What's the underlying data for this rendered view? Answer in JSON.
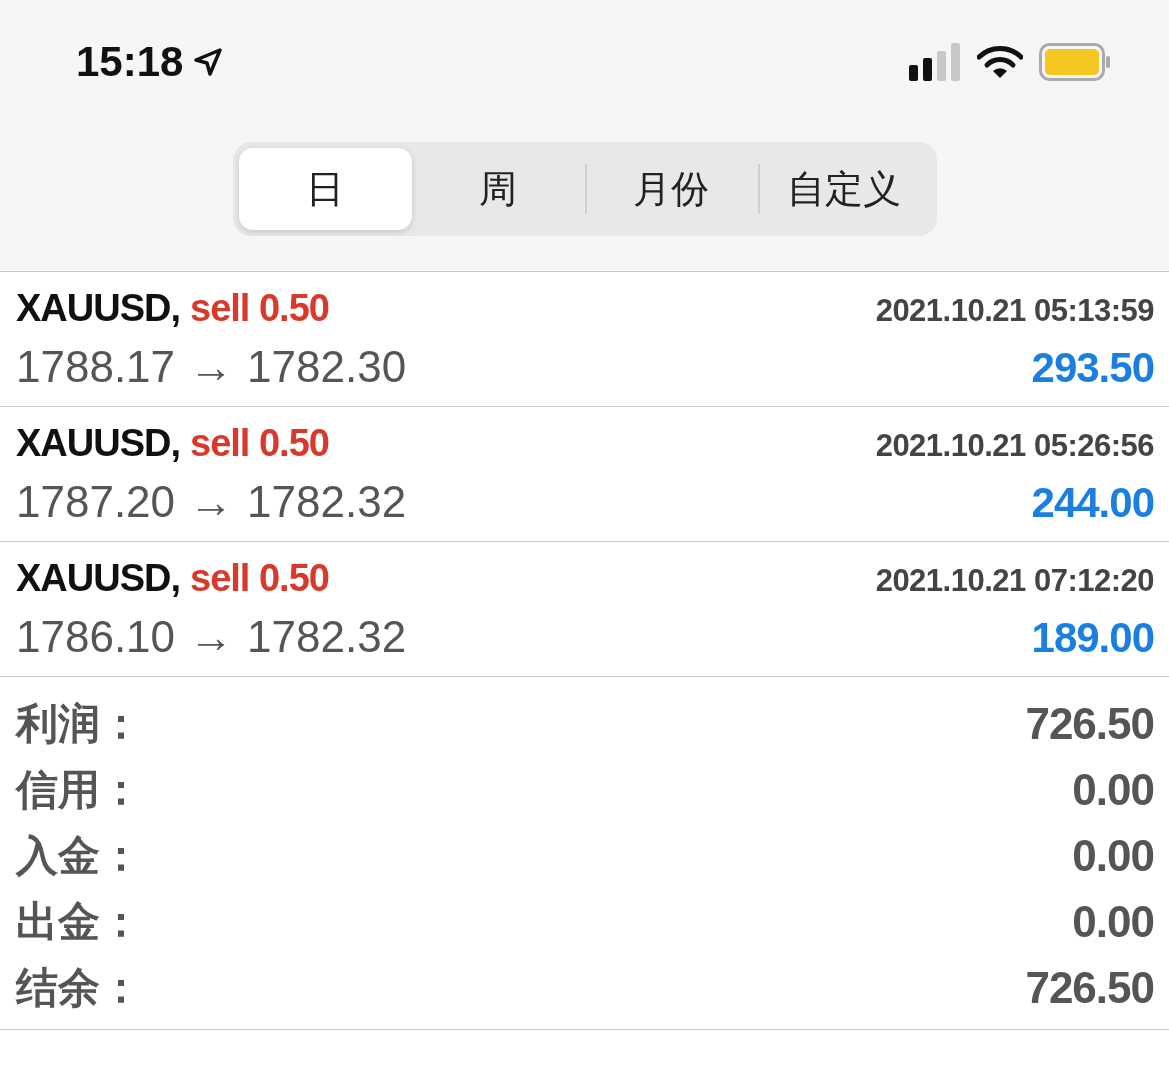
{
  "status_bar": {
    "time": "15:18"
  },
  "tabs": [
    {
      "label": "日",
      "selected": true
    },
    {
      "label": "周",
      "selected": false
    },
    {
      "label": "月份",
      "selected": false
    },
    {
      "label": "自定义",
      "selected": false
    }
  ],
  "trades": [
    {
      "symbol": "XAUUSD,",
      "kind": "short",
      "order": "sell 0.50",
      "time": "2021.10.21 05:13:59",
      "open_price": "1788.17",
      "arrow": "→",
      "close_price": "1782.30",
      "profit": "293.50"
    },
    {
      "symbol": "XAUUSD,",
      "kind": "short",
      "order": "sell 0.50",
      "time": "2021.10.21 05:26:56",
      "open_price": "1787.20",
      "arrow": "→",
      "close_price": "1782.32",
      "profit": "244.00"
    },
    {
      "symbol": "XAUUSD,",
      "kind": "short",
      "order": "sell 0.50",
      "time": "2021.10.21 07:12:20",
      "open_price": "1786.10",
      "arrow": "→",
      "close_price": "1782.32",
      "profit": "189.00"
    }
  ],
  "summary": [
    {
      "label": "利润：",
      "value": "726.50"
    },
    {
      "label": "信用：",
      "value": "0.00"
    },
    {
      "label": "入金：",
      "value": "0.00"
    },
    {
      "label": "出金：",
      "value": "0.00"
    },
    {
      "label": "结余：",
      "value": "726.50"
    }
  ]
}
